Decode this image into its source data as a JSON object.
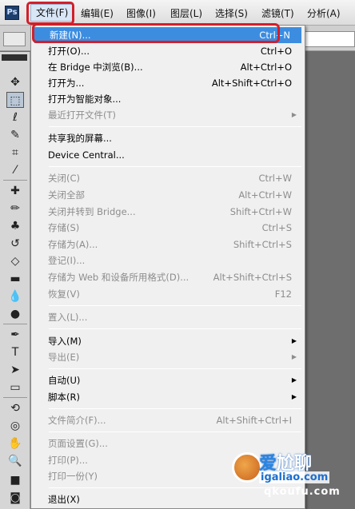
{
  "app": {
    "logo_text": "Ps"
  },
  "menubar": {
    "items": [
      {
        "label": "文件(F)"
      },
      {
        "label": "编辑(E)"
      },
      {
        "label": "图像(I)"
      },
      {
        "label": "图层(L)"
      },
      {
        "label": "选择(S)"
      },
      {
        "label": "滤镜(T)"
      },
      {
        "label": "分析(A)"
      }
    ]
  },
  "file_menu": {
    "items": [
      {
        "label": "新建(N)...",
        "shortcut": "Ctrl+N"
      },
      {
        "label": "打开(O)...",
        "shortcut": "Ctrl+O"
      },
      {
        "label": "在 Bridge 中浏览(B)...",
        "shortcut": "Alt+Ctrl+O"
      },
      {
        "label": "打开为...",
        "shortcut": "Alt+Shift+Ctrl+O"
      },
      {
        "label": "打开为智能对象...",
        "shortcut": ""
      },
      {
        "label": "最近打开文件(T)",
        "shortcut": ""
      },
      {
        "label": "共享我的屏幕...",
        "shortcut": ""
      },
      {
        "label": "Device Central...",
        "shortcut": ""
      },
      {
        "label": "关闭(C)",
        "shortcut": "Ctrl+W"
      },
      {
        "label": "关闭全部",
        "shortcut": "Alt+Ctrl+W"
      },
      {
        "label": "关闭并转到 Bridge...",
        "shortcut": "Shift+Ctrl+W"
      },
      {
        "label": "存储(S)",
        "shortcut": "Ctrl+S"
      },
      {
        "label": "存储为(A)...",
        "shortcut": "Shift+Ctrl+S"
      },
      {
        "label": "登记(I)...",
        "shortcut": ""
      },
      {
        "label": "存储为 Web 和设备所用格式(D)...",
        "shortcut": "Alt+Shift+Ctrl+S"
      },
      {
        "label": "恢复(V)",
        "shortcut": "F12"
      },
      {
        "label": "置入(L)...",
        "shortcut": ""
      },
      {
        "label": "导入(M)",
        "shortcut": ""
      },
      {
        "label": "导出(E)",
        "shortcut": ""
      },
      {
        "label": "自动(U)",
        "shortcut": ""
      },
      {
        "label": "脚本(R)",
        "shortcut": ""
      },
      {
        "label": "文件简介(F)...",
        "shortcut": "Alt+Shift+Ctrl+I"
      },
      {
        "label": "页面设置(G)...",
        "shortcut": ""
      },
      {
        "label": "打印(P)...",
        "shortcut": ""
      },
      {
        "label": "打印一份(Y)",
        "shortcut": ""
      },
      {
        "label": "退出(X)",
        "shortcut": ""
      }
    ]
  },
  "watermark": {
    "line1_a": "爱",
    "line1_b": "尬聊",
    "line2": "igaliao.com",
    "line3": "qkoufu.com"
  },
  "colors": {
    "highlight": "#3c8de0",
    "annotation_red": "#d21f2a",
    "menu_bg": "#f0f0f0",
    "disabled_text": "#8d8d8d"
  }
}
